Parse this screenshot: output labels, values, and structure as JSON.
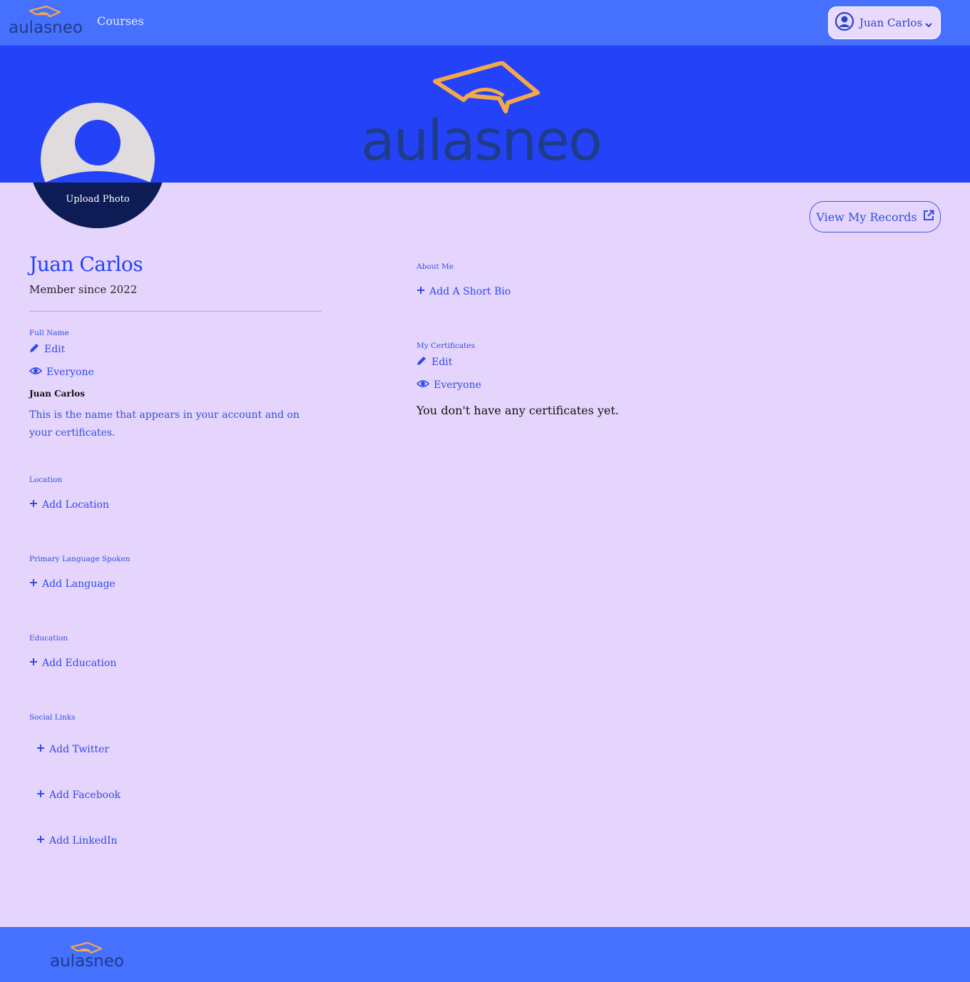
{
  "brand": {
    "name": "aulasneo",
    "colors": {
      "nav": "#4671fe",
      "banner": "#2442f7",
      "page_background": "#e5d5fc",
      "accent_orange": "#f5a84a",
      "logo_dark_text": "#1f3c88"
    }
  },
  "nav": {
    "courses_label": "Courses",
    "user_name": "Juan Carlos",
    "user_icon": "user-circle-icon",
    "menu_icon": "chevron-down-icon"
  },
  "profile": {
    "upload_photo_label": "Upload Photo",
    "view_records_label": "View My Records",
    "view_records_icon": "external-link-icon",
    "display_name": "Juan Carlos",
    "member_since": "Member since 2022"
  },
  "full_name": {
    "label": "Full Name",
    "edit_label": "Edit",
    "visibility": "Everyone",
    "value": "Juan Carlos",
    "helper": "This is the name that appears in your account and on your certificates."
  },
  "location": {
    "label": "Location",
    "add_label": "Add Location"
  },
  "language": {
    "label": "Primary Language Spoken",
    "add_label": "Add Language"
  },
  "education": {
    "label": "Education",
    "add_label": "Add Education"
  },
  "social": {
    "label": "Social Links",
    "twitter": "Add Twitter",
    "facebook": "Add Facebook",
    "linkedin": "Add LinkedIn"
  },
  "about": {
    "label": "About Me",
    "add_label": "Add A Short Bio"
  },
  "certificates": {
    "label": "My Certificates",
    "edit_label": "Edit",
    "visibility": "Everyone",
    "empty_text": "You don't have any certificates yet."
  }
}
